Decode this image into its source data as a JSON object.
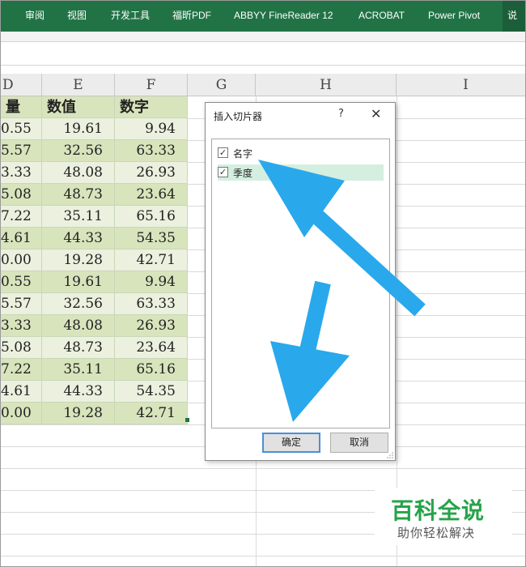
{
  "ribbon": {
    "tabs": [
      "审阅",
      "视图",
      "开发工具",
      "福昕PDF",
      "ABBYY FineReader 12",
      "ACROBAT",
      "Power Pivot",
      "说"
    ]
  },
  "columns": [
    "D",
    "E",
    "F",
    "G",
    "H",
    "I"
  ],
  "table": {
    "headers": [
      "量",
      "数值",
      "数字"
    ],
    "rows": [
      [
        "0.55",
        "19.61",
        "9.94"
      ],
      [
        "5.57",
        "32.56",
        "63.33"
      ],
      [
        "3.33",
        "48.08",
        "26.93"
      ],
      [
        "5.08",
        "48.73",
        "23.64"
      ],
      [
        "7.22",
        "35.11",
        "65.16"
      ],
      [
        "4.61",
        "44.33",
        "54.35"
      ],
      [
        "0.00",
        "19.28",
        "42.71"
      ],
      [
        "0.55",
        "19.61",
        "9.94"
      ],
      [
        "5.57",
        "32.56",
        "63.33"
      ],
      [
        "3.33",
        "48.08",
        "26.93"
      ],
      [
        "5.08",
        "48.73",
        "23.64"
      ],
      [
        "7.22",
        "35.11",
        "65.16"
      ],
      [
        "4.61",
        "44.33",
        "54.35"
      ],
      [
        "0.00",
        "19.28",
        "42.71"
      ]
    ]
  },
  "dialog": {
    "title": "插入切片器",
    "help": "?",
    "close": "✕",
    "items": [
      {
        "label": "名字",
        "checked": true
      },
      {
        "label": "季度",
        "checked": true
      }
    ],
    "ok_label": "确定",
    "cancel_label": "取消"
  },
  "watermark": {
    "title": "百科全说",
    "subtitle": "助你轻松解决"
  },
  "colors": {
    "ribbon": "#217346",
    "row_light": "#ebf1de",
    "row_dark": "#d8e4bc",
    "arrow": "#2aa8ec",
    "watermark_green": "#27a34a"
  }
}
